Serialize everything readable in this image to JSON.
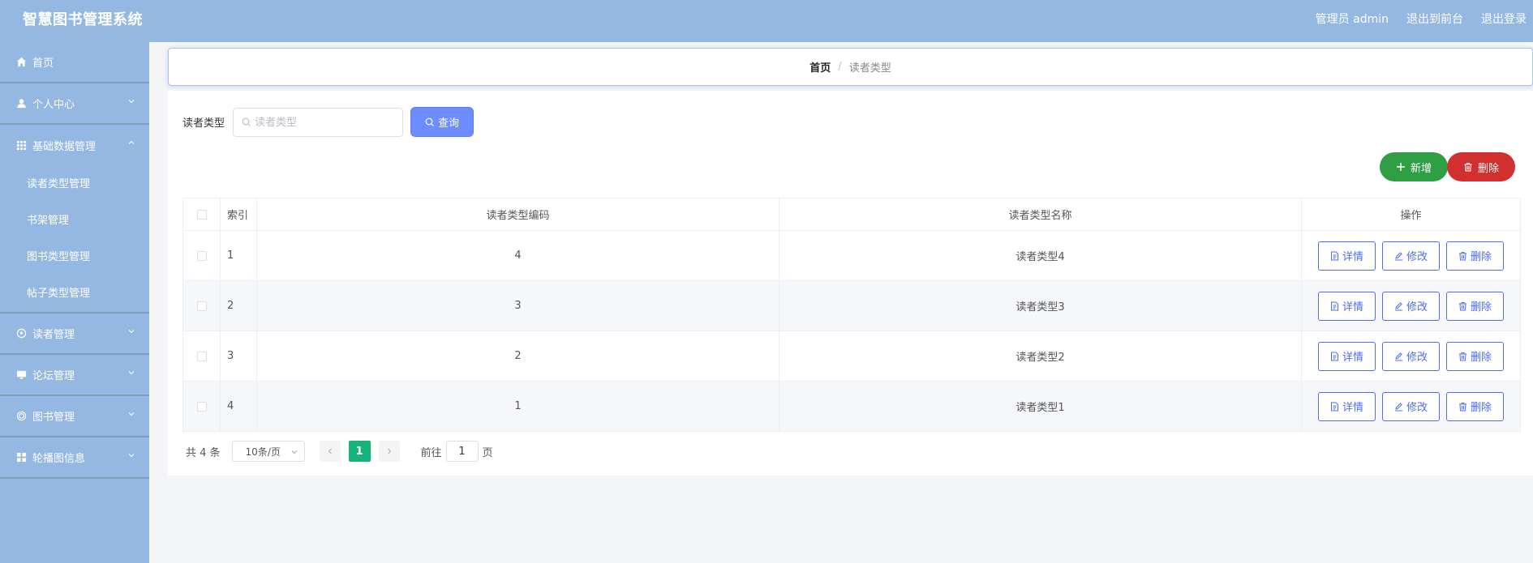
{
  "header": {
    "brand": "智慧图书管理系统",
    "admin_label": "管理员 admin",
    "to_front": "退出到前台",
    "logout": "退出登录"
  },
  "sidebar": {
    "items": [
      {
        "label": "首页",
        "icon": "home-icon"
      },
      {
        "label": "个人中心",
        "icon": "user-icon"
      },
      {
        "label": "基础数据管理",
        "icon": "grid-icon"
      },
      {
        "label": "读者管理",
        "icon": "reader-icon"
      },
      {
        "label": "论坛管理",
        "icon": "monitor-icon"
      },
      {
        "label": "图书管理",
        "icon": "target-icon"
      },
      {
        "label": "轮播图信息",
        "icon": "apps-icon"
      }
    ],
    "sub_items": [
      "读者类型管理",
      "书架管理",
      "图书类型管理",
      "帖子类型管理"
    ]
  },
  "breadcrumb": {
    "home": "首页",
    "separator": "/",
    "current": "读者类型"
  },
  "search": {
    "label": "读者类型",
    "placeholder": "读者类型",
    "value": "",
    "button": "查询"
  },
  "actions": {
    "add": "新增",
    "delete": "删除"
  },
  "table": {
    "headers": [
      "索引",
      "读者类型编码",
      "读者类型名称",
      "操作"
    ],
    "rows": [
      {
        "index": "1",
        "code": "4",
        "name": "读者类型4"
      },
      {
        "index": "2",
        "code": "3",
        "name": "读者类型3"
      },
      {
        "index": "3",
        "code": "2",
        "name": "读者类型2"
      },
      {
        "index": "4",
        "code": "1",
        "name": "读者类型1"
      }
    ],
    "row_actions": {
      "detail": "详情",
      "edit": "修改",
      "delete": "删除"
    }
  },
  "pagination": {
    "total": "共 4 条",
    "page_size": "10条/页",
    "current_page": "1",
    "goto_prefix": "前往",
    "goto_value": "1",
    "goto_suffix": "页"
  },
  "colors": {
    "header_bg": "#94b8e2",
    "query_btn": "#6d8cff",
    "add_btn": "#2ea043",
    "delete_btn": "#d22f2f",
    "active_page": "#17b37a",
    "op_btn_border": "#4d6ef3"
  }
}
